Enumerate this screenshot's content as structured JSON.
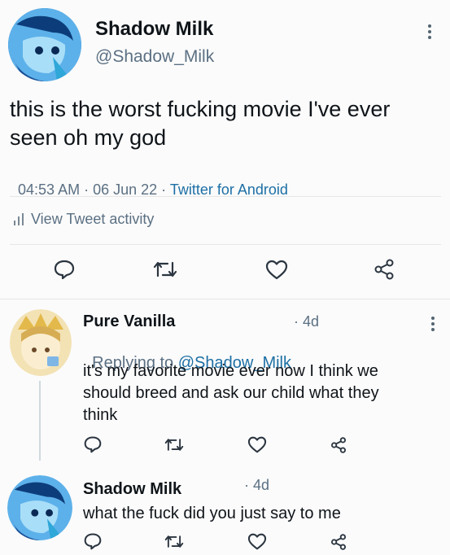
{
  "main_tweet": {
    "author_name": "Shadow Milk",
    "author_handle": "@Shadow_Milk",
    "text_line1": "this is the worst fucking movie I've ever",
    "text_line2": "seen oh my god",
    "timestamp": "04:53 AM · 06 Jun 22 · ",
    "source": "Twitter for Android",
    "activity_label": "View Tweet activity",
    "avatar_icon": "blue-jester-avatar"
  },
  "reply1": {
    "author_name": "Pure Vanilla",
    "age": "· 4d",
    "replying_prefix": "Replying to ",
    "replying_handle": "@Shadow_Milk",
    "text_line1": "it's my favorite movie ever now I think we",
    "text_line2": "should breed and ask our child what they",
    "text_line3": "think",
    "avatar_icon": "gold-king-avatar"
  },
  "reply2": {
    "author_name": "Shadow Milk",
    "age": "· 4d",
    "text_line1": "what the fuck did you just say to me",
    "avatar_icon": "blue-jester-avatar"
  },
  "colors": {
    "text": "#0f1419",
    "muted": "#5b7083",
    "link": "#1d6fa5",
    "background": "#fbfbfb"
  },
  "icons": [
    "comment-icon",
    "retweet-icon",
    "like-icon",
    "share-icon",
    "more-icon",
    "analytics-icon"
  ]
}
